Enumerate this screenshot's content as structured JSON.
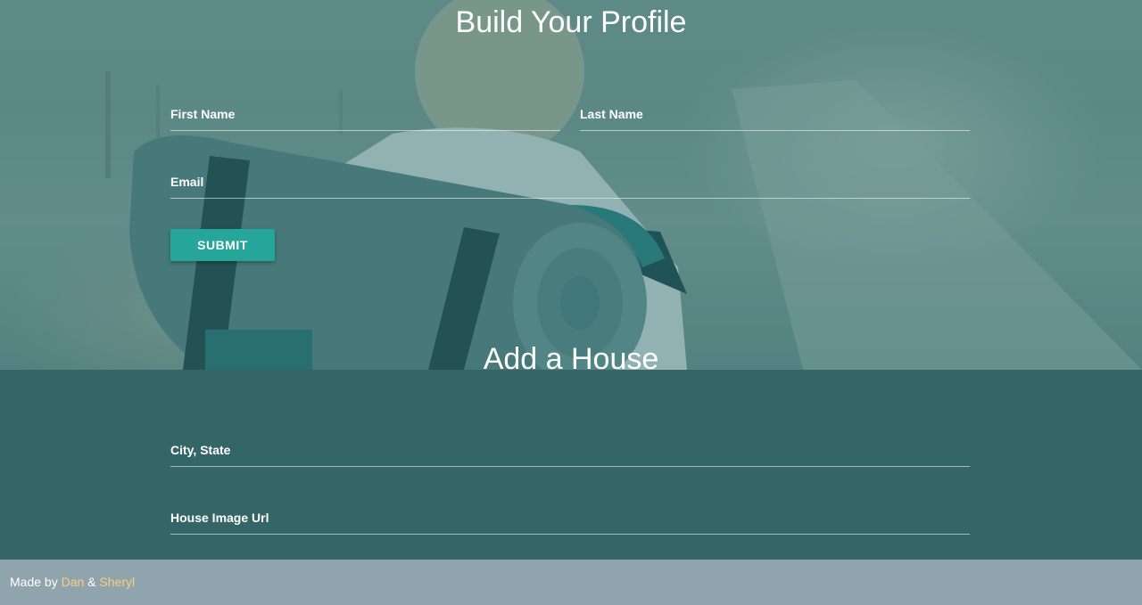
{
  "profile": {
    "title": "Build Your Profile",
    "first_name_label": "First Name",
    "last_name_label": "Last Name",
    "email_label": "Email",
    "submit_label": "SUBMIT"
  },
  "house": {
    "title": "Add a House",
    "city_state_label": "City, State",
    "image_url_label": "House Image Url"
  },
  "footer": {
    "prefix": "Made by ",
    "author1": "Dan",
    "separator": " & ",
    "author2": "Sheryl",
    "link_color": "#ffcc80"
  },
  "colors": {
    "accent": "#26a69a",
    "house_bg": "#356667",
    "footer_bg": "#90a4ae"
  }
}
